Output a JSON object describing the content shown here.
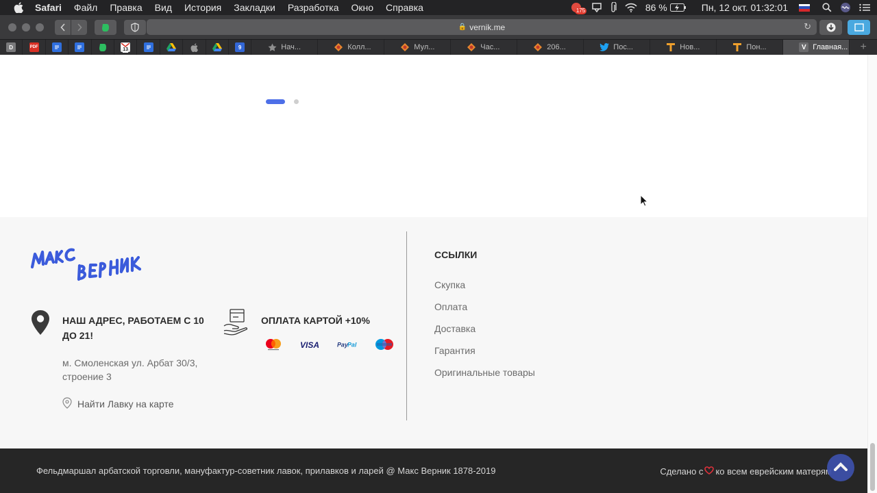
{
  "menubar": {
    "app_name": "Safari",
    "items": [
      "Файл",
      "Правка",
      "Вид",
      "История",
      "Закладки",
      "Разработка",
      "Окно",
      "Справка"
    ],
    "notification_count": "175",
    "battery": "86 %",
    "datetime": "Пн, 12 окт.  01:32:01"
  },
  "browser": {
    "url": "vernik.me",
    "pinned_tabs": [
      "D",
      "PDF",
      "docs",
      "docs",
      "evernote",
      "gmail",
      "docs",
      "drive",
      "apple",
      "drive",
      "9"
    ],
    "gmail_badge": "13",
    "calendar_badge": "9",
    "tabs": [
      {
        "title": "Нач...",
        "icon": "star-icon",
        "active": false
      },
      {
        "title": "Колл...",
        "icon": "shop-icon",
        "active": false
      },
      {
        "title": "Мул...",
        "icon": "shop-icon",
        "active": false
      },
      {
        "title": "Час...",
        "icon": "shop-icon",
        "active": false
      },
      {
        "title": "206...",
        "icon": "shop-icon",
        "active": false
      },
      {
        "title": "Пос...",
        "icon": "twitter-icon",
        "active": false
      },
      {
        "title": "Нов...",
        "icon": "t-icon",
        "active": false
      },
      {
        "title": "Пон...",
        "icon": "t-icon",
        "active": false
      },
      {
        "title": "Главная...",
        "icon": "v-icon",
        "active": true
      }
    ],
    "pinned_D": "D",
    "pinned_PDF": "PDF",
    "tab_icon_v": "V"
  },
  "footer": {
    "logo_text": "Макс Верник",
    "address_title": "НАШ АДРЕС, РАБОТАЕМ С 10 ДО 21!",
    "address_text": "м. Смоленская ул. Арбат 30/3, строение 3",
    "map_link": "Найти Лавку на карте",
    "payment_title": "ОПЛАТА КАРТОЙ +10%",
    "cards": [
      "mastercard",
      "VISA",
      "PayPal",
      "Maestro"
    ],
    "links_title": "ССЫЛКИ",
    "links": [
      "Скупка",
      "Оплата",
      "Доставка",
      "Гарантия",
      "Оригинальные товары"
    ],
    "copyright": "Фельдмаршал арбатской торговли, мануфактур-советник лавок, прилавков и ларей @ Макс Верник 1878-2019",
    "made_prefix": "Сделано с",
    "made_suffix": "ко всем еврейским матерям"
  },
  "colors": {
    "accent": "#4d6fe8",
    "logo": "#3b5bdb",
    "footer_bg": "#f7f7f7",
    "bottombar_bg": "#262626",
    "heart": "#e0323c"
  }
}
